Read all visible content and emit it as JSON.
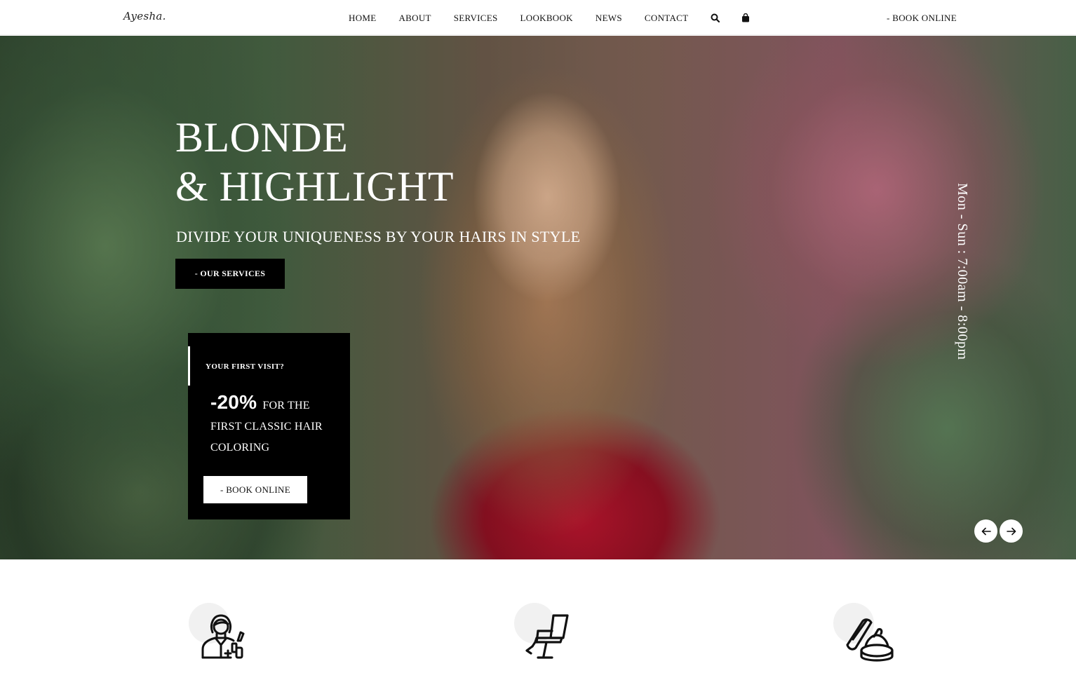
{
  "header": {
    "logo": "Ayesha.",
    "nav": [
      "HOME",
      "ABOUT",
      "SERVICES",
      "LOOKBOOK",
      "NEWS",
      "CONTACT"
    ],
    "book_online": "- BOOK ONLINE",
    "icons": [
      "search-icon",
      "shopping-bag-icon"
    ]
  },
  "hero": {
    "title_line1": "BLONDE",
    "title_line2": "& HIGHLIGHT",
    "subtitle": "DIVIDE YOUR UNIQUENESS BY YOUR HAIRS IN STYLE",
    "services_button": "- OUR SERVICES",
    "hours": "Mon - Sun : 7:00am - 8:00pm",
    "promo": {
      "label": "YOUR FIRST VISIT?",
      "discount": "-20%",
      "text": "FOR THE FIRST CLASSIC HAIR COLORING",
      "button": "- BOOK ONLINE"
    },
    "colors": {
      "dark": "#000000",
      "light": "#ffffff",
      "dress": "#b3142c"
    }
  },
  "features": {
    "icons": [
      "stylist-icon",
      "salon-chair-icon",
      "cosmetics-icon"
    ]
  }
}
